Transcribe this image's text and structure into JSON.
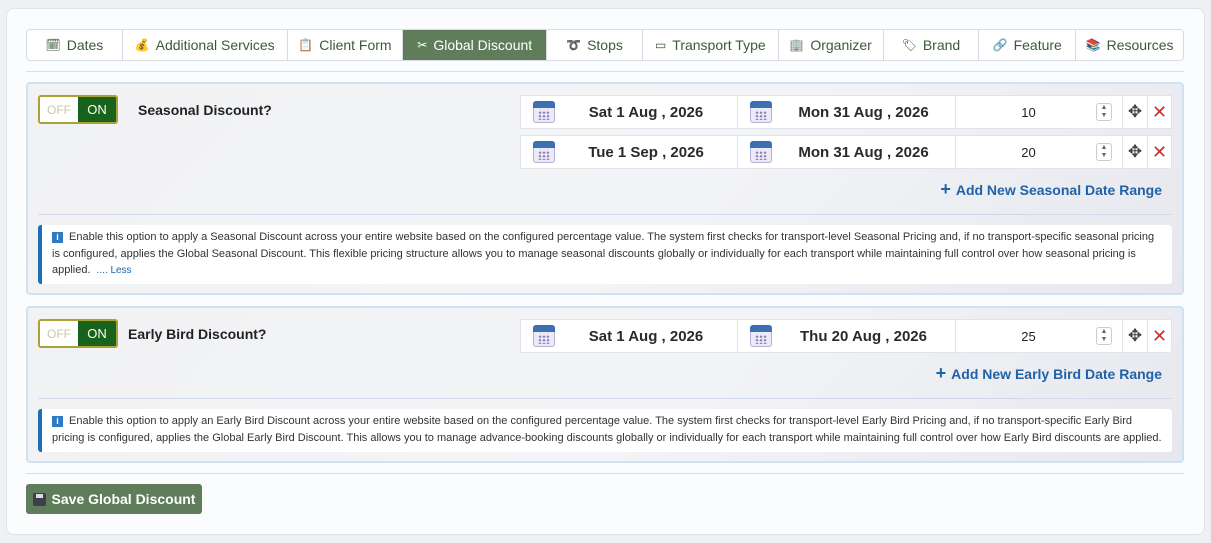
{
  "tabs": [
    {
      "icon": "calendar-icon",
      "glyph": "🗓",
      "label": "Dates"
    },
    {
      "icon": "money-bag-icon",
      "glyph": "💰",
      "label": "Additional Services"
    },
    {
      "icon": "clipboard-icon",
      "glyph": "📋",
      "label": "Client Form"
    },
    {
      "icon": "scissors-icon",
      "glyph": "✂",
      "label": "Global Discount"
    },
    {
      "icon": "route-icon",
      "glyph": "➰",
      "label": "Stops"
    },
    {
      "icon": "ticket-icon",
      "glyph": "▭",
      "label": "Transport Type"
    },
    {
      "icon": "building-icon",
      "glyph": "🏢",
      "label": "Organizer"
    },
    {
      "icon": "tag-icon",
      "glyph": "🏷",
      "label": "Brand"
    },
    {
      "icon": "link-icon",
      "glyph": "🔗",
      "label": "Feature"
    },
    {
      "icon": "books-icon",
      "glyph": "📚",
      "label": "Resources"
    }
  ],
  "active_tab": "Global Discount",
  "seasonal": {
    "toggle_off": "OFF",
    "toggle_on": "ON",
    "label": "Seasonal Discount?",
    "ranges": [
      {
        "start": "Sat 1 Aug , 2026",
        "end": "Mon 31 Aug , 2026",
        "percent": "10"
      },
      {
        "start": "Tue 1 Sep , 2026",
        "end": "Mon 31 Aug , 2026",
        "percent": "20"
      }
    ],
    "add_label": "Add New Seasonal Date Range",
    "info": "Enable this option to apply a Seasonal Discount across your entire website based on the configured percentage value. The system first checks for transport-level Seasonal Pricing and, if no transport-specific seasonal pricing is configured, applies the Global Seasonal Discount. This flexible pricing structure allows you to manage seasonal discounts globally or individually for each transport while maintaining full control over how seasonal pricing is applied.",
    "less_label": ".... Less"
  },
  "early_bird": {
    "toggle_off": "OFF",
    "toggle_on": "ON",
    "label": "Early Bird Discount?",
    "ranges": [
      {
        "start": "Sat 1 Aug , 2026",
        "end": "Thu 20 Aug , 2026",
        "percent": "25"
      }
    ],
    "add_label": "Add New Early Bird Date Range",
    "info": "Enable this option to apply an Early Bird Discount across your entire website based on the configured percentage value. The system first checks for transport-level Early Bird Pricing and, if no transport-specific Early Bird pricing is configured, applies the Global Early Bird Discount. This allows you to manage advance-booking discounts globally or individually for each transport while maintaining full control over how Early Bird discounts are applied."
  },
  "save_label": "Save Global Discount",
  "colors": {
    "accent": "#5f7d5b",
    "toggle_on": "#17631b",
    "link": "#1f62a8",
    "delete": "#d42b2b"
  }
}
